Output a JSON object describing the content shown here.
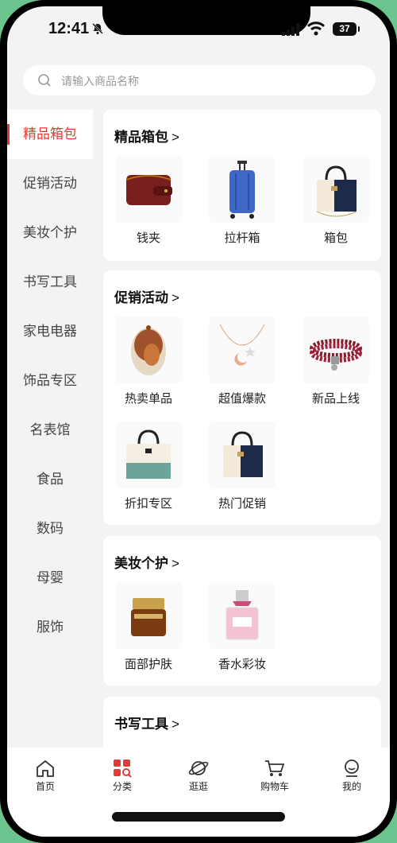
{
  "status": {
    "time": "12:41",
    "battery": "37"
  },
  "search": {
    "placeholder": "请输入商品名称"
  },
  "sidebar": {
    "items": [
      "精品箱包",
      "促销活动",
      "美妆个护",
      "书写工具",
      "家电电器",
      "饰品专区",
      "名表馆",
      "食品",
      "数码",
      "母婴",
      "服饰"
    ],
    "active_index": 0
  },
  "sections": [
    {
      "title": "精品箱包",
      "items": [
        "钱夹",
        "拉杆箱",
        "箱包"
      ]
    },
    {
      "title": "促销活动",
      "items": [
        "热卖单品",
        "超值爆款",
        "新品上线",
        "折扣专区",
        "热门促销"
      ]
    },
    {
      "title": "美妆个护",
      "items": [
        "面部护肤",
        "香水彩妆"
      ]
    },
    {
      "title": "书写工具",
      "items": []
    }
  ],
  "tabbar": {
    "items": [
      "首页",
      "分类",
      "逛逛",
      "购物车",
      "我的"
    ],
    "active_index": 1
  },
  "colors": {
    "accent": "#e53935",
    "background": "#f3f3f3",
    "frame_bg": "#6cc58e"
  }
}
